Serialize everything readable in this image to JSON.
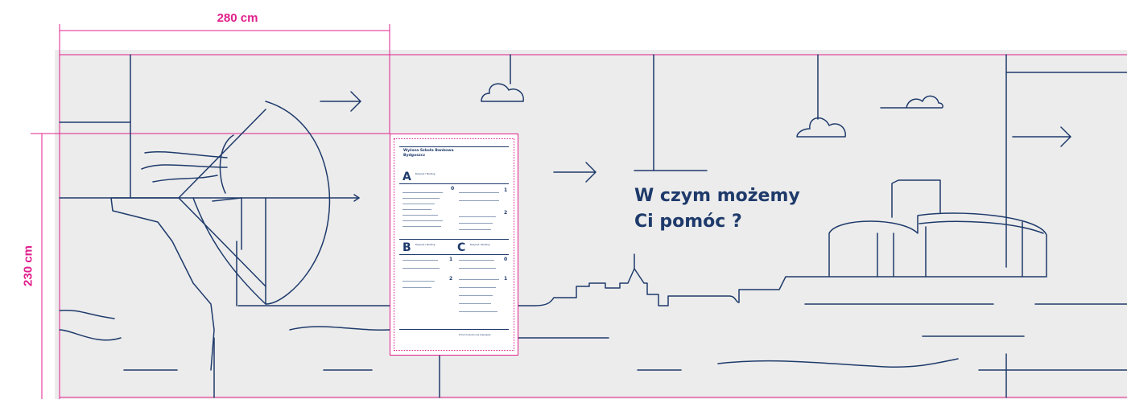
{
  "dimensions": {
    "width_label": "280 cm",
    "height_label": "230 cm"
  },
  "headline": {
    "line1": "W czym możemy",
    "line2": "Ci pomóc ?"
  },
  "panel": {
    "title_line1": "Wyższa Szkoła Bankowa",
    "title_line2": "Bydgoszcz",
    "section_a": "A",
    "section_b": "B",
    "section_c": "C",
    "subtitle_a": "Budynek / Building",
    "subtitle_b": "Budynek / Building",
    "subtitle_c": "Budynek / Building",
    "floor_0": "0",
    "floor_1": "1",
    "floor_2": "2",
    "footer": "W tym budynku się znajdujesz"
  },
  "colors": {
    "line": "#1e3a6b",
    "dimension": "#e0208c",
    "wall": "#ececec"
  }
}
